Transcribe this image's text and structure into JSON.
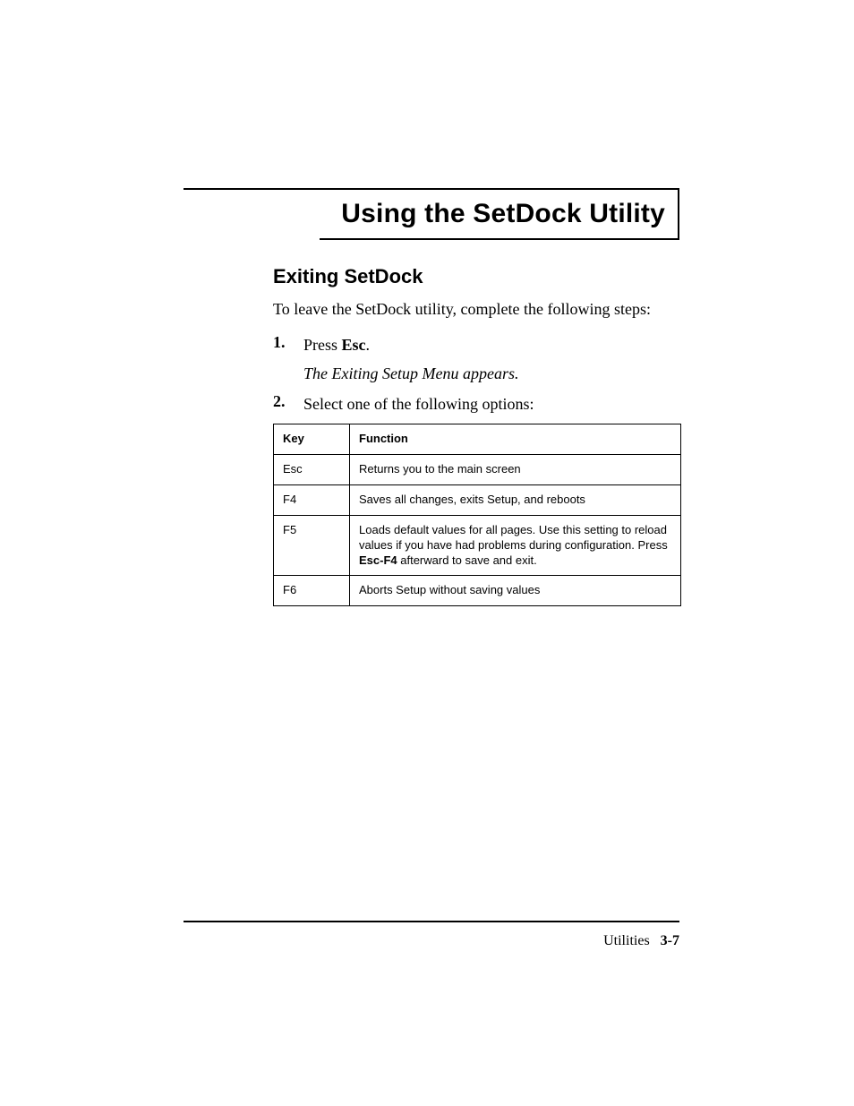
{
  "chapter": {
    "title": "Using the SetDock Utility"
  },
  "section": {
    "title": "Exiting SetDock"
  },
  "intro": "To leave the SetDock utility, complete the following steps:",
  "steps": {
    "s1": {
      "num": "1.",
      "pre": "Press ",
      "key": "Esc",
      "post": ".",
      "sub": "The Exiting Setup Menu appears."
    },
    "s2": {
      "num": "2.",
      "text": "Select one of the following options:"
    }
  },
  "table": {
    "headers": {
      "key": "Key",
      "func": "Function"
    },
    "rows": {
      "r0": {
        "key": "Esc",
        "func": "Returns you to the main screen"
      },
      "r1": {
        "key": "F4",
        "func": "Saves all changes, exits Setup, and reboots"
      },
      "r2": {
        "key": "F5",
        "func_pre": "Loads default values for all pages.  Use this setting to reload values if you have had problems during configuration.  Press ",
        "func_key": "Esc-F4",
        "func_post": " afterward to save and exit."
      },
      "r3": {
        "key": "F6",
        "func": "Aborts Setup without saving values"
      }
    }
  },
  "footer": {
    "section": "Utilities",
    "page": "3-7"
  }
}
